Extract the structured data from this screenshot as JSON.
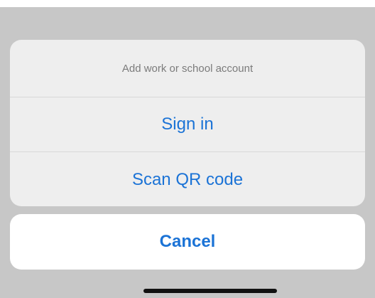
{
  "sheet": {
    "title": "Add work or school account",
    "actions": [
      {
        "label": "Sign in"
      },
      {
        "label": "Scan QR code"
      }
    ]
  },
  "cancel": {
    "label": "Cancel"
  },
  "colors": {
    "accent": "#1b73d6",
    "backdrop": "#c7c7c7",
    "sheet_background": "#eeeeee",
    "cancel_background": "#ffffff"
  }
}
